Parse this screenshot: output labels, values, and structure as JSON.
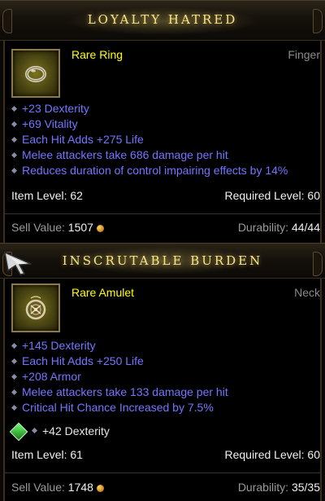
{
  "tooltips": [
    {
      "title": "LOYALTY HATRED",
      "item_type": "Rare Ring",
      "slot": "Finger",
      "icon": "ring-icon",
      "affixes": [
        "+23 Dexterity",
        "+69 Vitality",
        "Each Hit Adds +275 Life",
        "Melee attackers take 686 damage per hit",
        "Reduces duration of control impairing effects by 14%"
      ],
      "item_level_label": "Item Level:",
      "item_level": "62",
      "required_level_label": "Required Level:",
      "required_level": "60",
      "sell_value_label": "Sell Value:",
      "sell_value": "1507",
      "durability_label": "Durability:",
      "durability": "44/44"
    },
    {
      "title": "INSCRUTABLE BURDEN",
      "item_type": "Rare Amulet",
      "slot": "Neck",
      "icon": "amulet-icon",
      "affixes": [
        "+145 Dexterity",
        "Each Hit Adds +250 Life",
        "+208 Armor",
        "Melee attackers take 133 damage per hit",
        "Critical Hit Chance Increased by 7.5%"
      ],
      "socket": {
        "icon": "emerald-gem-icon",
        "text": "+42 Dexterity"
      },
      "item_level_label": "Item Level:",
      "item_level": "61",
      "required_level_label": "Required Level:",
      "required_level": "60",
      "sell_value_label": "Sell Value:",
      "sell_value": "1748",
      "durability_label": "Durability:",
      "durability": "35/35"
    }
  ],
  "colors": {
    "title": "#f6e58a",
    "rare_name": "#ffff00",
    "magic_affix": "#7575ff",
    "slot_text": "#8a8a8a"
  }
}
